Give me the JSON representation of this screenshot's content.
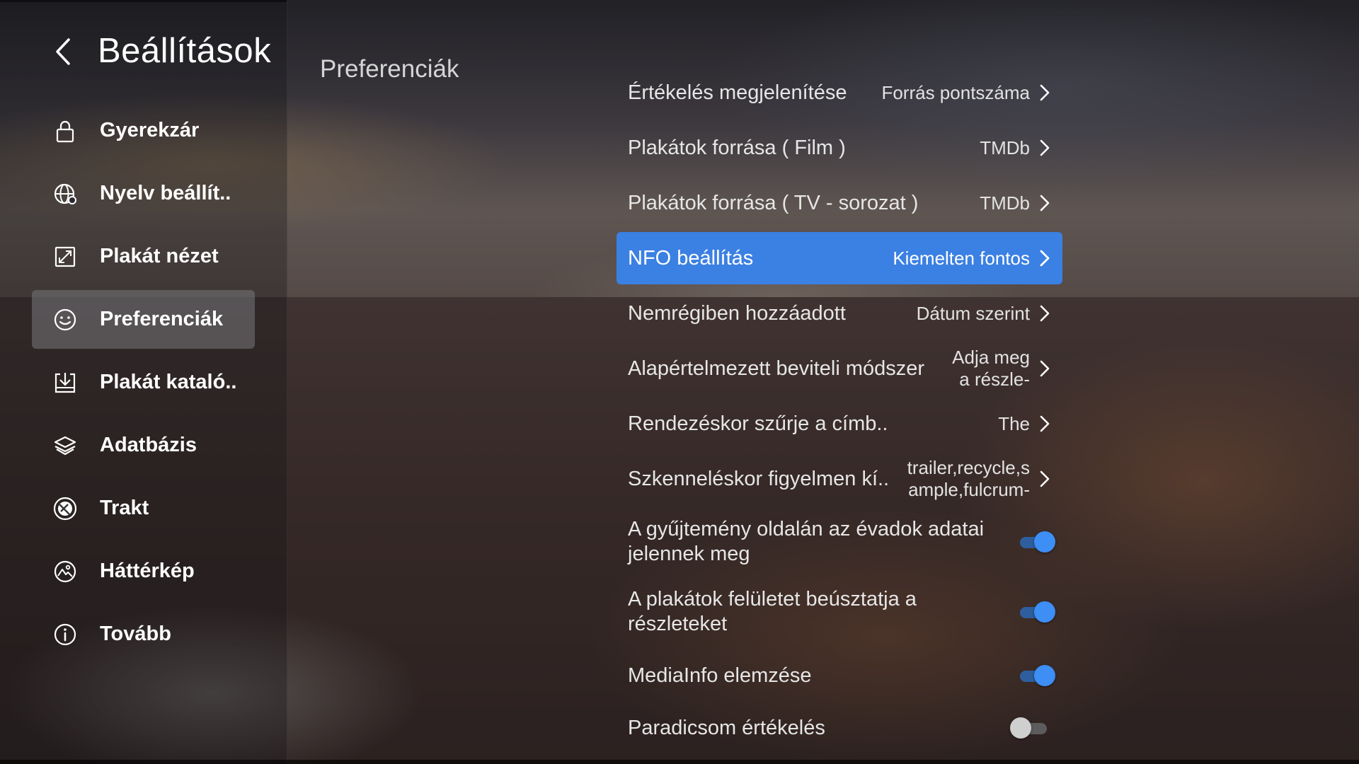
{
  "app": {
    "title": "Beállítások"
  },
  "sidebar": {
    "items": [
      {
        "label": "Gyerekzár",
        "icon": "lock-icon"
      },
      {
        "label": "Nyelv beállít..",
        "icon": "globe-icon"
      },
      {
        "label": "Plakát nézet",
        "icon": "expand-icon"
      },
      {
        "label": "Preferenciák",
        "icon": "smiley-icon",
        "active": true
      },
      {
        "label": "Plakát kataló..",
        "icon": "download-icon"
      },
      {
        "label": "Adatbázis",
        "icon": "database-icon"
      },
      {
        "label": "Trakt",
        "icon": "trakt-icon"
      },
      {
        "label": "Háttérkép",
        "icon": "wallpaper-icon"
      },
      {
        "label": "Tovább",
        "icon": "info-icon"
      }
    ]
  },
  "main": {
    "section_title": "Preferenciák",
    "rows": [
      {
        "label": "Értékelés megjelenítése",
        "value": "Forrás pontszáma"
      },
      {
        "label": "Plakátok forrása ( Film )",
        "value": "TMDb"
      },
      {
        "label": "Plakátok forrása ( TV - sorozat )",
        "value": "TMDb"
      },
      {
        "label": "NFO beállítás",
        "value": "Kiemelten fontos",
        "selected": true
      },
      {
        "label": "Nemrégiben hozzáadott",
        "value": "Dátum szerint"
      },
      {
        "label": "Alapértelmezett beviteli módszer",
        "value_line1": "Adja meg",
        "value_line2": "a részle-"
      },
      {
        "label": "Rendezéskor szűrje a címb..",
        "value": "The"
      },
      {
        "label": "Szkenneléskor figyelmen kí..",
        "value_line1": "trailer,recycle,s",
        "value_line2": "ample,fulcrum-"
      }
    ],
    "toggles": [
      {
        "label": "A gyűjtemény oldalán az évadok adatai jelennek meg",
        "on": true
      },
      {
        "label": "A plakátok felületet beúsztatja a részleteket",
        "on": true
      },
      {
        "label": "MediaInfo elemzése",
        "on": true
      },
      {
        "label": "Paradicsom értékelés",
        "on": false
      }
    ]
  },
  "colors": {
    "accent": "#3b80e3",
    "toggle_on": "#3d8ef5",
    "toggle_off": "#cfcfcf"
  }
}
